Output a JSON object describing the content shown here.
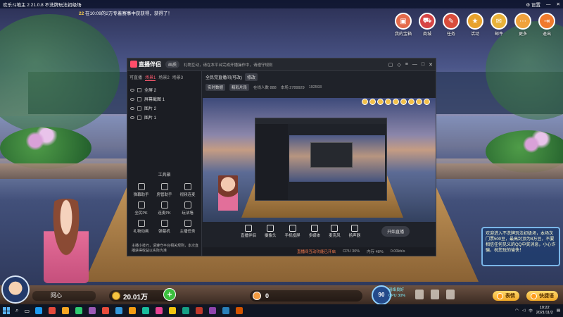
{
  "game": {
    "window_title": "欢乐斗地主 2.21.0.8  不洗牌玩法初级场",
    "settings_label": "设置",
    "marquee_prefix": "22",
    "marquee_text": "在10:09的2万专着赛事中获获得，获得了！",
    "top_icons": [
      {
        "label": "我的宝箱",
        "glyph": "▣",
        "color": "#e46b4b"
      },
      {
        "label": "商城",
        "glyph": "🛒",
        "color": "#d64545"
      },
      {
        "label": "任务",
        "glyph": "✎",
        "color": "#d94c3b"
      },
      {
        "label": "活动",
        "glyph": "★",
        "color": "#e8a22c"
      },
      {
        "label": "邮件",
        "glyph": "✉",
        "color": "#e9b23a"
      },
      {
        "label": "更多",
        "glyph": "⋯",
        "color": "#f0a23c"
      },
      {
        "label": "退出",
        "glyph": "⇥",
        "color": "#f07a2d"
      }
    ],
    "chat_text": "欢迎进入不洗牌玩法初级场，本场次门票500豆，最高封顶为8万豆，不要相信任何见义的QQ中奖消息，小心诈骗，祝您玩的愉快！",
    "player_name": "阿心",
    "coins": "20.01万",
    "beans": "0",
    "level_value": "90",
    "net_status_1": "网络良好",
    "net_status_2": "CPU 30%",
    "emoji_button": "表情",
    "quick_button": "快捷语"
  },
  "app": {
    "logo_text": "直播伴侣",
    "mode_pill": "画质",
    "subtitle": "礼物互动，请在本平台完成开播操作中，请遵守规则",
    "scene_tabs": [
      "可直播",
      "场景1",
      "场景2",
      "场景3"
    ],
    "active_tab_index": 1,
    "layers": [
      "全屏 2",
      "屏幕截图 1",
      "图片 2",
      "图片 1"
    ],
    "tools_title": "工具箱",
    "tools": [
      "弹幕助手",
      "房管助手",
      "视频连麦",
      "全民PK",
      "连麦PK",
      "玩法墙",
      "礼物动画",
      "弹幕机",
      "主播任务"
    ],
    "notice": "主播小技巧，请遵守平台相关规则，本次直播获得收益以实际为准",
    "room_title": "全民党直播间(可改)",
    "edit_tag": "修改",
    "meta_tag_1": "实时数据",
    "meta_tag_2": "精彩片段",
    "meta_stats": [
      "在线人数 888",
      "本场 2789929",
      "192593"
    ],
    "controls": [
      "直播伴侣",
      "摄像头",
      "手机投屏",
      "多媒体",
      "麦克风",
      "扬声器"
    ],
    "start_button": "开始直播",
    "status_warn": "直播间互动功能已开启",
    "status_items": [
      "CPU 30%",
      "内存 48%",
      "0.00kb/s"
    ]
  },
  "taskbar": {
    "clock_time": "10:22",
    "clock_date": "2021/11/2",
    "lang": "中",
    "app_colors": [
      "#1d9bf0",
      "#e64a3c",
      "#f5a623",
      "#2ecc71",
      "#9b59b6",
      "#e74c3c",
      "#3498db",
      "#f39c12",
      "#1abc9c",
      "#e84393",
      "#f1c40f",
      "#16a085",
      "#c0392b",
      "#8e44ad",
      "#2980b9",
      "#d35400"
    ]
  }
}
